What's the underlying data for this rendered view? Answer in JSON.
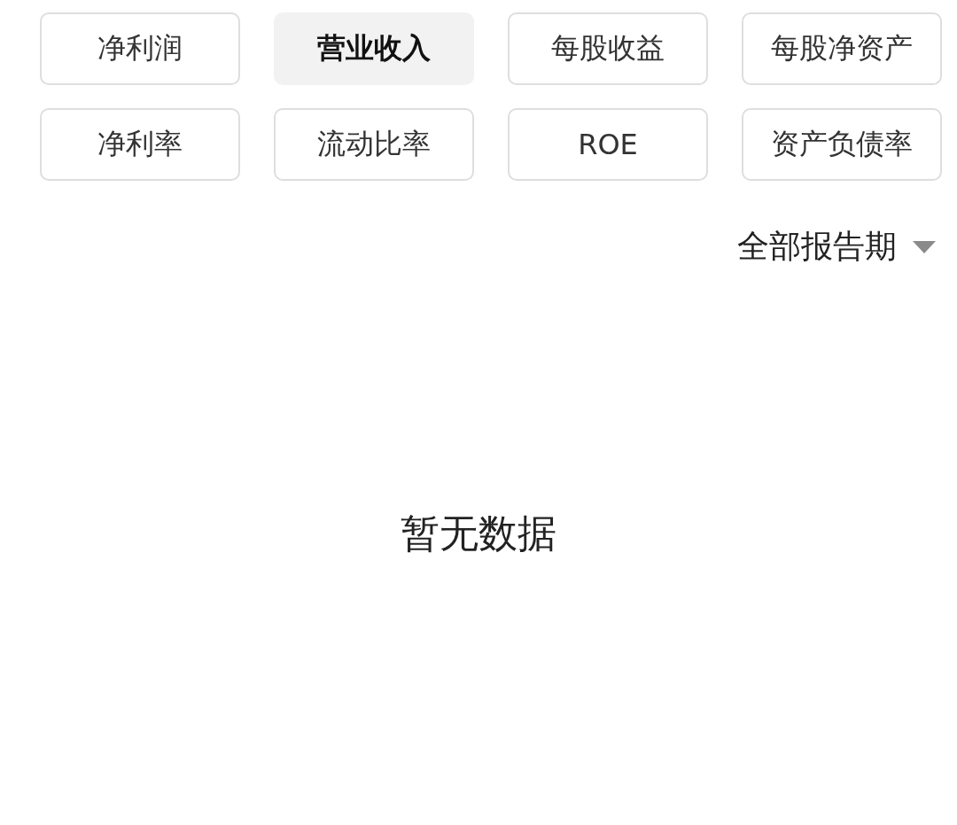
{
  "metrics": [
    {
      "label": "净利润",
      "selected": false
    },
    {
      "label": "营业收入",
      "selected": true
    },
    {
      "label": "每股收益",
      "selected": false
    },
    {
      "label": "每股净资产",
      "selected": false
    },
    {
      "label": "净利率",
      "selected": false
    },
    {
      "label": "流动比率",
      "selected": false
    },
    {
      "label": "ROE",
      "selected": false
    },
    {
      "label": "资产负债率",
      "selected": false
    }
  ],
  "period_dropdown": {
    "value": "全部报告期"
  },
  "empty_message": "暂无数据"
}
